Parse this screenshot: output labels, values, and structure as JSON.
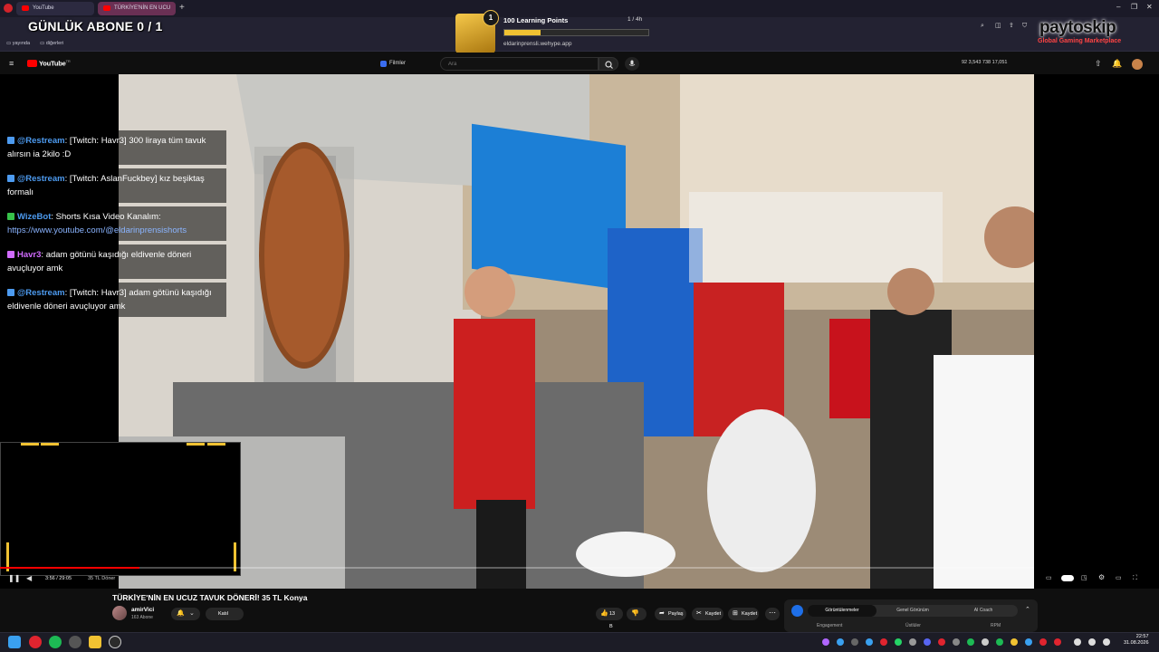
{
  "browser": {
    "tabs": [
      {
        "label": "YouTube"
      },
      {
        "label": "TÜRKİYE'NİN EN UCU"
      }
    ],
    "add_tab_glyph": "+",
    "bookmarks": [
      {
        "label": "yayında"
      },
      {
        "label": "diğerleri"
      }
    ],
    "window_controls": [
      "–",
      "❐",
      "✕"
    ]
  },
  "overlay": {
    "sub_counter": "GÜNLÜK ABONE 0 / 1",
    "learning_points": {
      "rank": "1",
      "title": "100 Learning Points",
      "progress_text": "1 / 4h",
      "progress_fraction": 0.25,
      "url": "eldarinprensli.wehype.app"
    },
    "brand": {
      "name": "paytoskip",
      "tagline": "Global Gaming Marketplace"
    }
  },
  "youtube": {
    "logo": "YouTube",
    "logo_suffix": "TR",
    "films_chip": "Filmler",
    "search_placeholder": "Ara",
    "stats": "92  3,543  738  17,051",
    "video": {
      "title": "TÜRKİYE'NİN EN UCUZ TAVUK DÖNERİ! 35 TL Konya",
      "time": "3:56 / 29:05",
      "chapter": "35 TL Döner",
      "progress_fraction": 0.135
    },
    "channel": {
      "name": "amirVici",
      "subscribers": "163 Abone"
    },
    "join_label": "Katıl",
    "actions": [
      {
        "icon": "like-icon",
        "label": "13 B"
      },
      {
        "icon": "dislike-icon",
        "label": ""
      },
      {
        "icon": "share-icon",
        "label": "Paylaş"
      },
      {
        "icon": "clip-icon",
        "label": "Kaydet"
      },
      {
        "icon": "save-icon",
        "label": "Kaydet"
      }
    ],
    "insights": {
      "tabs": [
        "Görüntülenmeler",
        "Genel Görünüm",
        "AI Coach"
      ],
      "columns": [
        "Engagement",
        "Üstlüler",
        "RPM"
      ]
    }
  },
  "chat": [
    {
      "user": "@Restream",
      "text": ": [Twitch: Havr3] 300 liraya tüm tavuk alırsın ia 2kilo :D",
      "icon_color": "#4d9bf0",
      "user_style": "blue"
    },
    {
      "user": "@Restream",
      "text": ": [Twitch: AslanFuckbey] kız beşiktaş formalı",
      "icon_color": "#4d9bf0",
      "user_style": "blue"
    },
    {
      "user": "WizeBot",
      "text": ": Shorts Kısa Video Kanalım: ",
      "link": "https://www.youtube.com/@eldarinprensishorts",
      "icon_color": "#37c24a",
      "user_style": "blue"
    },
    {
      "user": "Havr3",
      "text": ": adam götünü kaşıdığı eldivenle döneri avuçluyor amk",
      "icon_color": "#d16bff",
      "user_style": "purple"
    },
    {
      "user": "@Restream",
      "text": ": [Twitch: Havr3] adam götünü kaşıdığı eldivenle döneri avuçluyor amk",
      "icon_color": "#4d9bf0",
      "user_style": "blue"
    }
  ],
  "taskbar": {
    "time": "22:57",
    "date": "31.08.2026"
  },
  "colors": {
    "accent": "#ff0000",
    "bar": "#f1c232",
    "link": "#4d9bf0"
  }
}
